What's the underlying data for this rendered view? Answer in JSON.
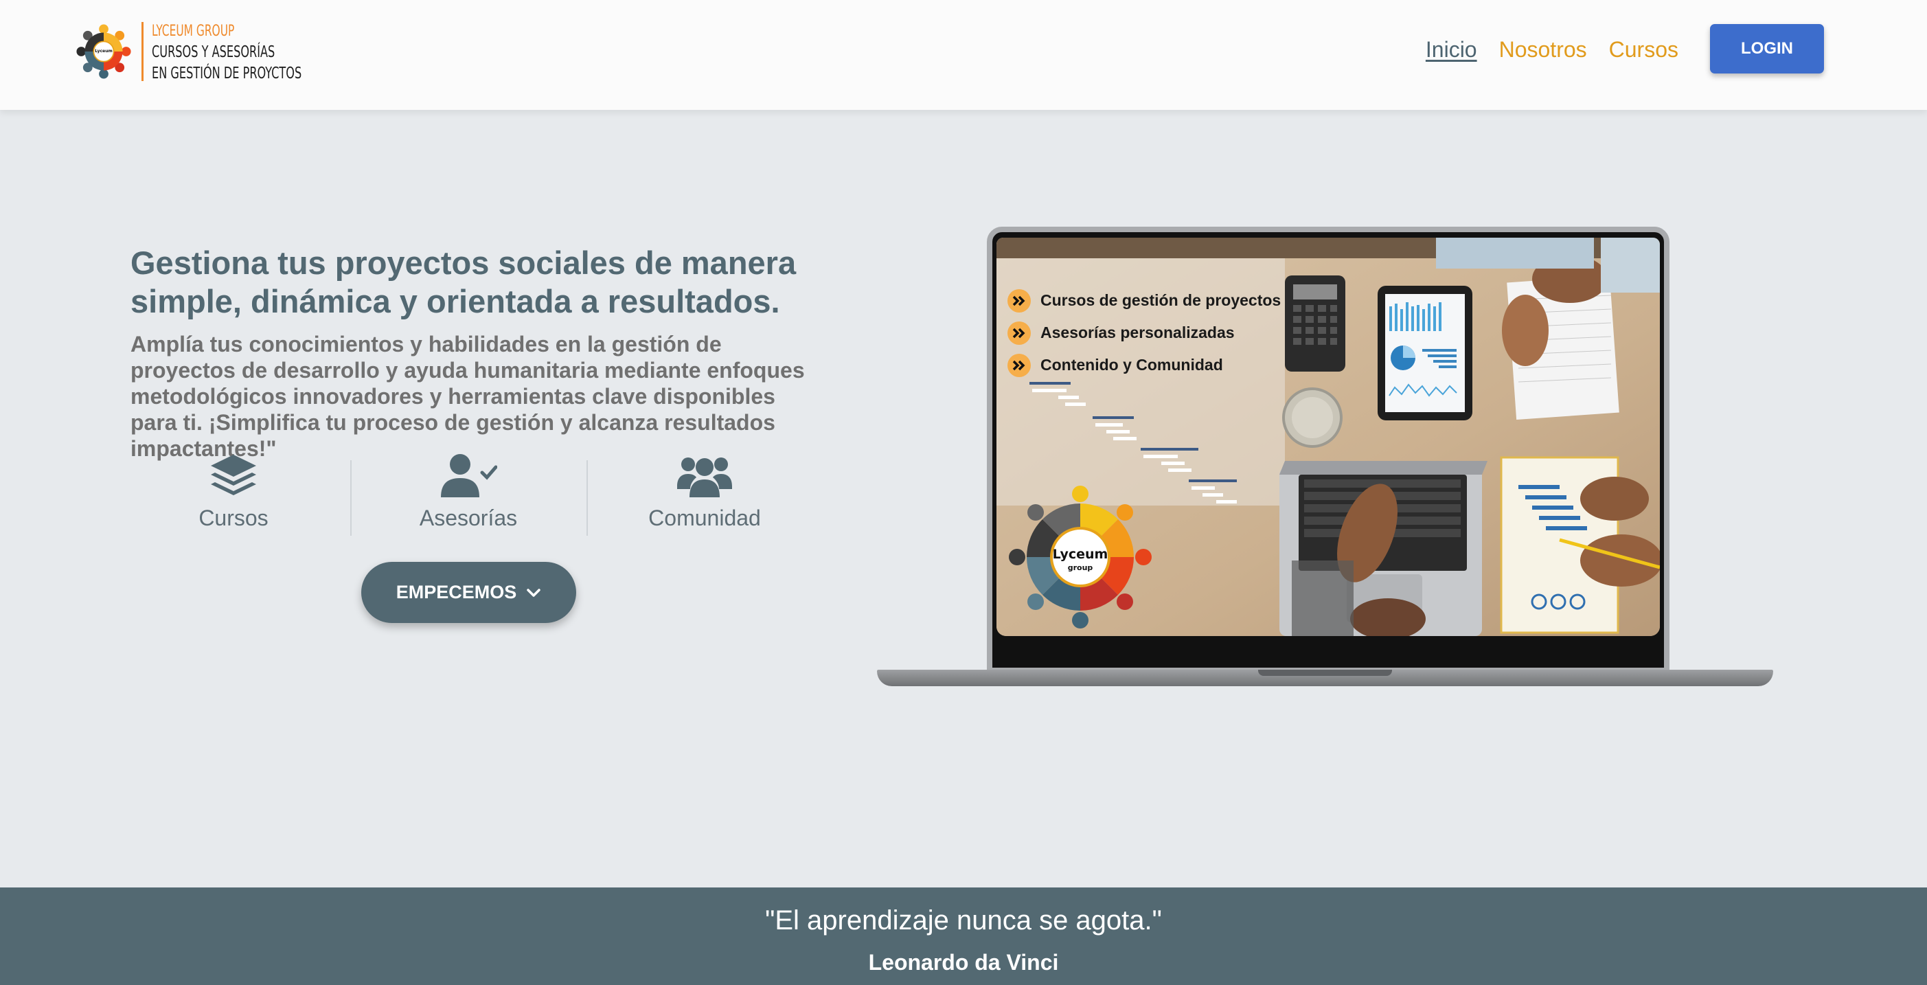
{
  "header": {
    "logo": {
      "brand": "LYCEUM GROUP",
      "line1": "CURSOS Y ASESORÍAS",
      "line2": "EN GESTIÓN DE PROYCTOS",
      "emblem_text": "Lyceum group"
    },
    "nav": [
      {
        "label": "Inicio",
        "active": true
      },
      {
        "label": "Nosotros",
        "active": false
      },
      {
        "label": "Cursos",
        "active": false
      }
    ],
    "login_label": "LOGIN"
  },
  "hero": {
    "title": "Gestiona tus proyectos sociales de manera simple, dinámica y orientada a resultados.",
    "description": "Amplía tus conocimientos y habilidades en la gestión de proyectos de desarrollo y ayuda humanitaria mediante enfoques metodológicos innovadores y herramientas clave disponibles para ti. ¡Simplifica tu proceso de gestión y alcanza resultados impactantes!\"",
    "features": [
      {
        "icon": "layers-icon",
        "label": "Cursos"
      },
      {
        "icon": "user-check-icon",
        "label": "Asesorías"
      },
      {
        "icon": "users-icon",
        "label": "Comunidad"
      }
    ],
    "cta_label": "EMPECEMOS"
  },
  "laptop_screen": {
    "items": [
      "Cursos de gestión de proyectos",
      "Asesorías personalizadas",
      "Contenido y Comunidad"
    ],
    "emblem_title": "Lyceum",
    "emblem_sub": "group"
  },
  "quote": {
    "text": "\"El aprendizaje nunca se agota.\"",
    "author": "Leonardo da Vinci"
  },
  "colors": {
    "accent_orange": "#e19b1c",
    "login_blue": "#3d6dcc",
    "slate": "#526872",
    "background": "#e7eaed"
  }
}
